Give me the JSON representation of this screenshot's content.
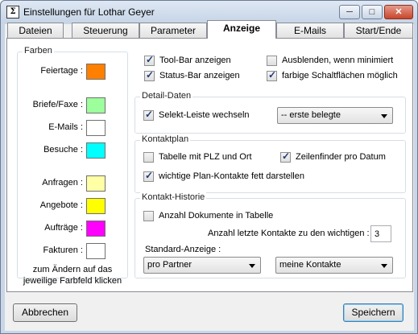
{
  "window": {
    "title": "Einstellungen für Lothar Geyer",
    "app_icon_glyph": "Σ",
    "minimize_glyph": "─",
    "maximize_glyph": "□",
    "close_glyph": "✕"
  },
  "tabs": [
    {
      "label": "Dateien"
    },
    {
      "label": "Steuerung"
    },
    {
      "label": "Parameter"
    },
    {
      "label": "Anzeige",
      "active": true
    },
    {
      "label": "E-Mails"
    },
    {
      "label": "Start/Ende"
    }
  ],
  "farben": {
    "title": "Farben",
    "items": [
      {
        "label": "Feiertage :",
        "color": "#ff7f00"
      },
      {
        "label": "Briefe/Faxe :",
        "color": "#9cff9c"
      },
      {
        "label": "E-Mails :",
        "color": "#ffffff"
      },
      {
        "label": "Besuche :",
        "color": "#00ffff"
      },
      {
        "label": "Anfragen :",
        "color": "#ffffa6"
      },
      {
        "label": "Angebote :",
        "color": "#ffff00"
      },
      {
        "label": "Aufträge :",
        "color": "#ff00ff"
      },
      {
        "label": "Fakturen :",
        "color": "#ffffff"
      }
    ],
    "hint_line1": "zum Ändern auf das",
    "hint_line2": "jeweilige Farbfeld klicken"
  },
  "general": {
    "toolbar": {
      "label": "Tool-Bar anzeigen",
      "checked": true
    },
    "statusbar": {
      "label": "Status-Bar anzeigen",
      "checked": true
    },
    "hide_min": {
      "label": "Ausblenden, wenn minimiert",
      "checked": false
    },
    "colored_buttons": {
      "label": "farbige Schaltflächen möglich",
      "checked": true
    }
  },
  "detail": {
    "title": "Detail-Daten",
    "selekt": {
      "label": "Selekt-Leiste wechseln",
      "checked": true
    },
    "combo_value": "-- erste belegte"
  },
  "kontaktplan": {
    "title": "Kontaktplan",
    "plz": {
      "label": "Tabelle mit PLZ und Ort",
      "checked": false
    },
    "zeilenfinder": {
      "label": "Zeilenfinder pro Datum",
      "checked": true
    },
    "fett": {
      "label": "wichtige Plan-Kontakte fett darstellen",
      "checked": true
    }
  },
  "historie": {
    "title": "Kontakt-Historie",
    "anzahl_dok": {
      "label": "Anzahl Dokumente in Tabelle",
      "checked": false
    },
    "anzahl_label": "Anzahl letzte Kontakte zu den wichtigen :",
    "anzahl_value": "3",
    "standard_label": "Standard-Anzeige :",
    "combo1_value": "pro Partner",
    "combo2_value": "meine Kontakte"
  },
  "buttons": {
    "cancel": "Abbrechen",
    "save": "Speichern"
  }
}
